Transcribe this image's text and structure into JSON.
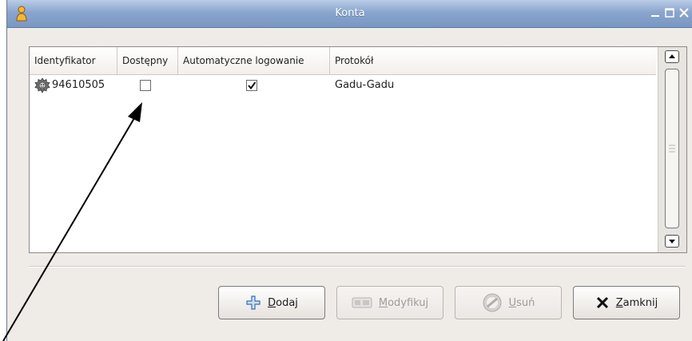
{
  "window": {
    "title": "Konta",
    "controls": [
      "minimize-icon",
      "maximize-icon",
      "close-icon"
    ]
  },
  "columns": [
    {
      "label": "Identyfikator"
    },
    {
      "label": "Dostępny"
    },
    {
      "label": "Automatyczne logowanie"
    },
    {
      "label": "Protokół"
    }
  ],
  "rows": [
    {
      "identifier": "94610505",
      "icon": "gear-icon",
      "available": false,
      "auto_login": true,
      "protocol": "Gadu-Gadu"
    }
  ],
  "buttons": {
    "add": {
      "label": "Dodaj",
      "icon": "plus-icon",
      "enabled": true
    },
    "modify": {
      "label": "Modyfikuj",
      "icon": "edit-icon",
      "enabled": false
    },
    "remove": {
      "label": "Usuń",
      "icon": "forbidden-icon",
      "enabled": false
    },
    "close": {
      "label": "Zamknij",
      "icon": "x-icon",
      "enabled": true
    }
  },
  "colors": {
    "titlebar": "#8aa5cd",
    "window_bg": "#efebe7",
    "list_bg": "#ffffff"
  }
}
